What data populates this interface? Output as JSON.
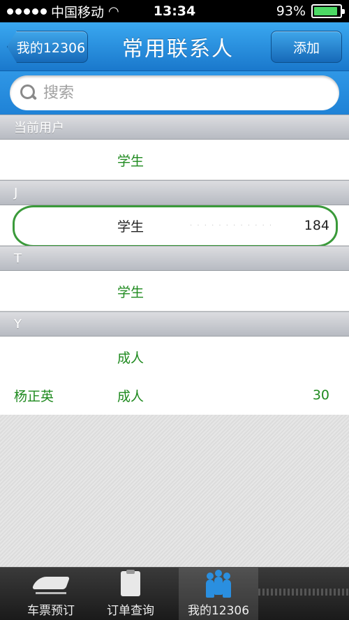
{
  "status_bar": {
    "carrier": "中国移动",
    "time": "13:34",
    "battery_percent": "93%",
    "battery_level": 0.93,
    "battery_color": "#4cd964"
  },
  "nav": {
    "back_label": "我的12306",
    "title": "常用联系人",
    "add_label": "添加"
  },
  "search": {
    "placeholder": "搜索"
  },
  "sections": {
    "current_user": {
      "header": "当前用户",
      "rows": [
        {
          "name": "",
          "type": "学生",
          "number": ""
        }
      ]
    },
    "j": {
      "header": "J",
      "rows": [
        {
          "name": "",
          "type": "学生",
          "number": "184"
        }
      ]
    },
    "t": {
      "header": "T",
      "rows": [
        {
          "name": "",
          "type": "学生",
          "number": ""
        }
      ]
    },
    "y": {
      "header": "Y",
      "rows": [
        {
          "name": "",
          "type": "成人",
          "number": ""
        },
        {
          "name": "杨正英",
          "type": "成人",
          "number": "30"
        }
      ]
    }
  },
  "tabs": [
    {
      "label": "车票预订",
      "icon": "train-icon"
    },
    {
      "label": "订单查询",
      "icon": "clipboard-icon"
    },
    {
      "label": "我的12306",
      "icon": "people-icon",
      "active": true
    }
  ],
  "colors": {
    "accent": "#1a78cc",
    "text_green": "#1f8a1f",
    "highlight_ring": "#3a9a3a"
  }
}
